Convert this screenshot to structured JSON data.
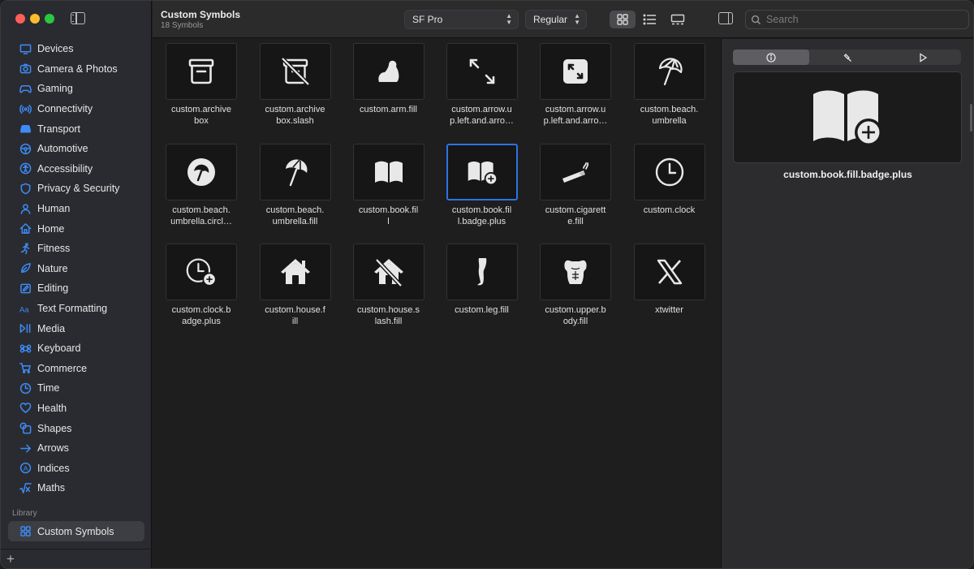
{
  "sidebar": {
    "categories": [
      {
        "label": "Devices",
        "icon": "display-icon"
      },
      {
        "label": "Camera & Photos",
        "icon": "camera-icon"
      },
      {
        "label": "Gaming",
        "icon": "gamecontroller-icon"
      },
      {
        "label": "Connectivity",
        "icon": "antenna-icon"
      },
      {
        "label": "Transport",
        "icon": "car-icon"
      },
      {
        "label": "Automotive",
        "icon": "steering-wheel-icon"
      },
      {
        "label": "Accessibility",
        "icon": "accessibility-icon"
      },
      {
        "label": "Privacy & Security",
        "icon": "lock-icon"
      },
      {
        "label": "Human",
        "icon": "person-icon"
      },
      {
        "label": "Home",
        "icon": "house-icon"
      },
      {
        "label": "Fitness",
        "icon": "figure-run-icon"
      },
      {
        "label": "Nature",
        "icon": "leaf-icon"
      },
      {
        "label": "Editing",
        "icon": "pencil-icon"
      },
      {
        "label": "Text Formatting",
        "icon": "textformat-icon"
      },
      {
        "label": "Media",
        "icon": "play-pause-icon"
      },
      {
        "label": "Keyboard",
        "icon": "command-icon"
      },
      {
        "label": "Commerce",
        "icon": "cart-icon"
      },
      {
        "label": "Time",
        "icon": "clock-icon"
      },
      {
        "label": "Health",
        "icon": "heart-icon"
      },
      {
        "label": "Shapes",
        "icon": "shapes-icon"
      },
      {
        "label": "Arrows",
        "icon": "arrow-right-icon"
      },
      {
        "label": "Indices",
        "icon": "indices-icon"
      },
      {
        "label": "Maths",
        "icon": "sqrt-icon"
      }
    ],
    "library_header": "Library",
    "library_item": "Custom Symbols"
  },
  "toolbar": {
    "title": "Custom Symbols",
    "subtitle": "18 Symbols",
    "font_value": "SF Pro",
    "weight_value": "Regular",
    "search_placeholder": "Search"
  },
  "symbols": [
    {
      "name": "custom.archive\nbox",
      "icon": "archivebox-icon"
    },
    {
      "name": "custom.archive\nbox.slash",
      "icon": "archivebox-slash-icon"
    },
    {
      "name": "custom.arm.fill",
      "icon": "arm-icon"
    },
    {
      "name": "custom.arrow.u\np.left.and.arro…",
      "icon": "arrow-diagonal-icon"
    },
    {
      "name": "custom.arrow.u\np.left.and.arro…",
      "icon": "arrow-diagonal-square-icon"
    },
    {
      "name": "custom.beach.\numbrella",
      "icon": "beach-umbrella-icon"
    },
    {
      "name": "custom.beach.\numbrella.circl…",
      "icon": "beach-umbrella-circle-icon"
    },
    {
      "name": "custom.beach.\numbrella.fill",
      "icon": "beach-umbrella-fill-icon"
    },
    {
      "name": "custom.book.fil\nl",
      "icon": "book-icon"
    },
    {
      "name": "custom.book.fil\nl.badge.plus",
      "icon": "book-badge-plus-icon"
    },
    {
      "name": "custom.cigarett\ne.fill",
      "icon": "cigarette-icon"
    },
    {
      "name": "custom.clock",
      "icon": "clock-icon"
    },
    {
      "name": "custom.clock.b\nadge.plus",
      "icon": "clock-badge-plus-icon"
    },
    {
      "name": "custom.house.f\nill",
      "icon": "house-fill-icon"
    },
    {
      "name": "custom.house.s\nlash.fill",
      "icon": "house-slash-icon"
    },
    {
      "name": "custom.leg.fill",
      "icon": "leg-icon"
    },
    {
      "name": "custom.upper.b\nody.fill",
      "icon": "upper-body-icon"
    },
    {
      "name": "xtwitter",
      "icon": "x-logo-icon"
    }
  ],
  "selected_index": 9,
  "inspector": {
    "tabs": [
      "info-icon",
      "hammer-icon",
      "play-icon"
    ],
    "selected_name": "custom.book.fill.badge.plus"
  },
  "colors": {
    "accent": "#3d8bf6",
    "selection": "#2b73e6"
  }
}
